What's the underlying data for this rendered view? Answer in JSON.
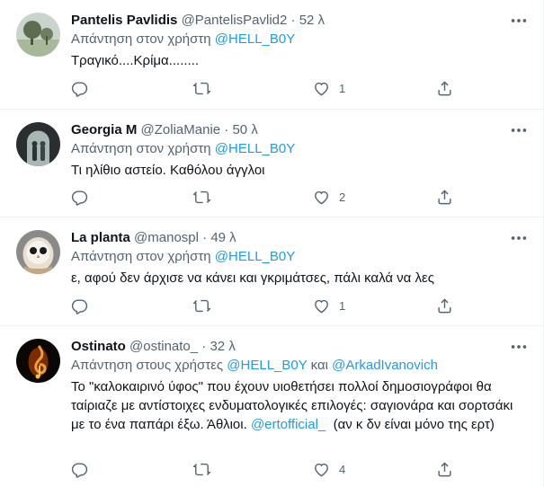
{
  "tweets": [
    {
      "name": "Pantelis Pavlidis",
      "handle": "@PantelisPavlid2",
      "separator": "·",
      "time": "52 λ",
      "reply_prefix": "Απάντηση στον χρήστη ",
      "mention1": "@HELL_B0Y",
      "text": "Τραγικό....Κρίμα........",
      "counts": {
        "reply": "",
        "retweet": "",
        "like": "1"
      },
      "avatar_icon": "landscape-tree-avatar"
    },
    {
      "name": "Georgia M",
      "handle": "@ZoliaManie",
      "separator": "·",
      "time": "50 λ",
      "reply_prefix": "Απάντηση στον χρήστη ",
      "mention1": "@HELL_B0Y",
      "text": "Τι ηλίθιο αστείο. Καθόλου άγγλοι",
      "counts": {
        "reply": "",
        "retweet": "",
        "like": "2"
      },
      "avatar_icon": "arch-figures-avatar"
    },
    {
      "name": "La planta",
      "handle": "@manospl",
      "separator": "·",
      "time": "49 λ",
      "reply_prefix": "Απάντηση στον χρήστη ",
      "mention1": "@HELL_B0Y",
      "text": "ε, αφού δεν άρχισε να κάνει και γκριμάτσες, πάλι καλά να λες",
      "counts": {
        "reply": "",
        "retweet": "",
        "like": "1"
      },
      "avatar_icon": "owl-avatar"
    },
    {
      "name": "Ostinato",
      "handle": "@ostinato_",
      "separator": "·",
      "time": "32 λ",
      "reply_prefix": "Απάντηση στους χρήστες ",
      "mention1": "@HELL_B0Y",
      "joiner": " και ",
      "mention2": "@ArkadIvanovich",
      "text_part1": "Το \"καλοκαιρινό ύφος\" που έχουν υιοθετήσει πολλοί δημοσιογράφοι θα ταίριαζε με αντίστοιχες ενδυματολογικές επιλογές: σαγιονάρα και σορτσάκι με το ένα παπάρι έξω. Άθλιοι. ",
      "text_mention": "@ertofficial_",
      "text_part2": "  (αν κ δν είναι μόνο της ερτ)",
      "counts": {
        "reply": "",
        "retweet": "",
        "like": "4"
      },
      "avatar_icon": "fire-clef-avatar"
    }
  ],
  "icons": {
    "more": "more-horizontal-icon",
    "reply": "reply-icon",
    "retweet": "retweet-icon",
    "like": "heart-icon",
    "share": "share-icon"
  },
  "colors": {
    "link": "#1d9bf0",
    "secondary": "#536471",
    "divider": "#eff3f4"
  }
}
